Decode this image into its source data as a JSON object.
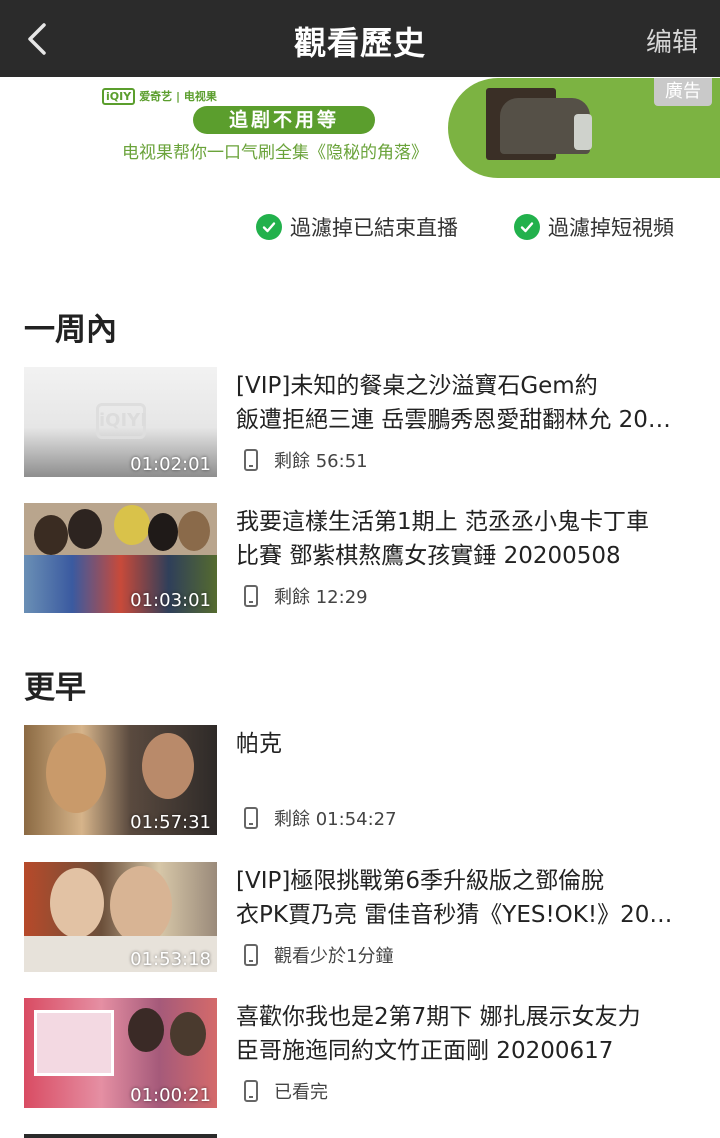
{
  "header": {
    "title": "觀看歷史",
    "edit_label": "编辑"
  },
  "ad": {
    "brand": "爱奇艺 | 电视果",
    "brand_logo": "iQIY",
    "headline": "追剧不用等",
    "slogan": "电视果帮你一口气刷全集《隐秘的角落》",
    "badge": "廣告"
  },
  "filters": [
    {
      "label": "過濾掉已結束直播",
      "checked": true
    },
    {
      "label": "過濾掉短視頻",
      "checked": true
    }
  ],
  "sections": [
    {
      "title": "一周內",
      "items": [
        {
          "title_line1": "[VIP]未知的餐桌之沙溢寶石Gem約",
          "title_line2": "飯遭拒絕三連 岳雲鵬秀恩愛甜翻林允 20…",
          "duration": "01:02:01",
          "status": "剩餘 56:51",
          "thumb_watermark": "iQIYI"
        },
        {
          "title_line1": "我要這樣生活第1期上 范丞丞小鬼卡丁車",
          "title_line2": "比賽 鄧紫棋熬鷹女孩實錘 20200508",
          "duration": "01:03:01",
          "status": "剩餘 12:29"
        }
      ]
    },
    {
      "title": "更早",
      "items": [
        {
          "title_line1": "帕克",
          "title_line2": "",
          "duration": "01:57:31",
          "status": "剩餘 01:54:27"
        },
        {
          "title_line1": "[VIP]極限挑戰第6季升級版之鄧倫脫",
          "title_line2": "衣PK賈乃亮 雷佳音秒猜《YES!OK!》20…",
          "duration": "01:53:18",
          "status": "觀看少於1分鐘"
        },
        {
          "title_line1": "喜歡你我也是2第7期下 娜扎展示女友力",
          "title_line2": "臣哥施迤同約文竹正面剛 20200617",
          "duration": "01:00:21",
          "status": "已看完"
        }
      ]
    }
  ],
  "colors": {
    "header_bg": "#2b2b2b",
    "check_green": "#22b14c",
    "ad_green": "#7cb342"
  }
}
